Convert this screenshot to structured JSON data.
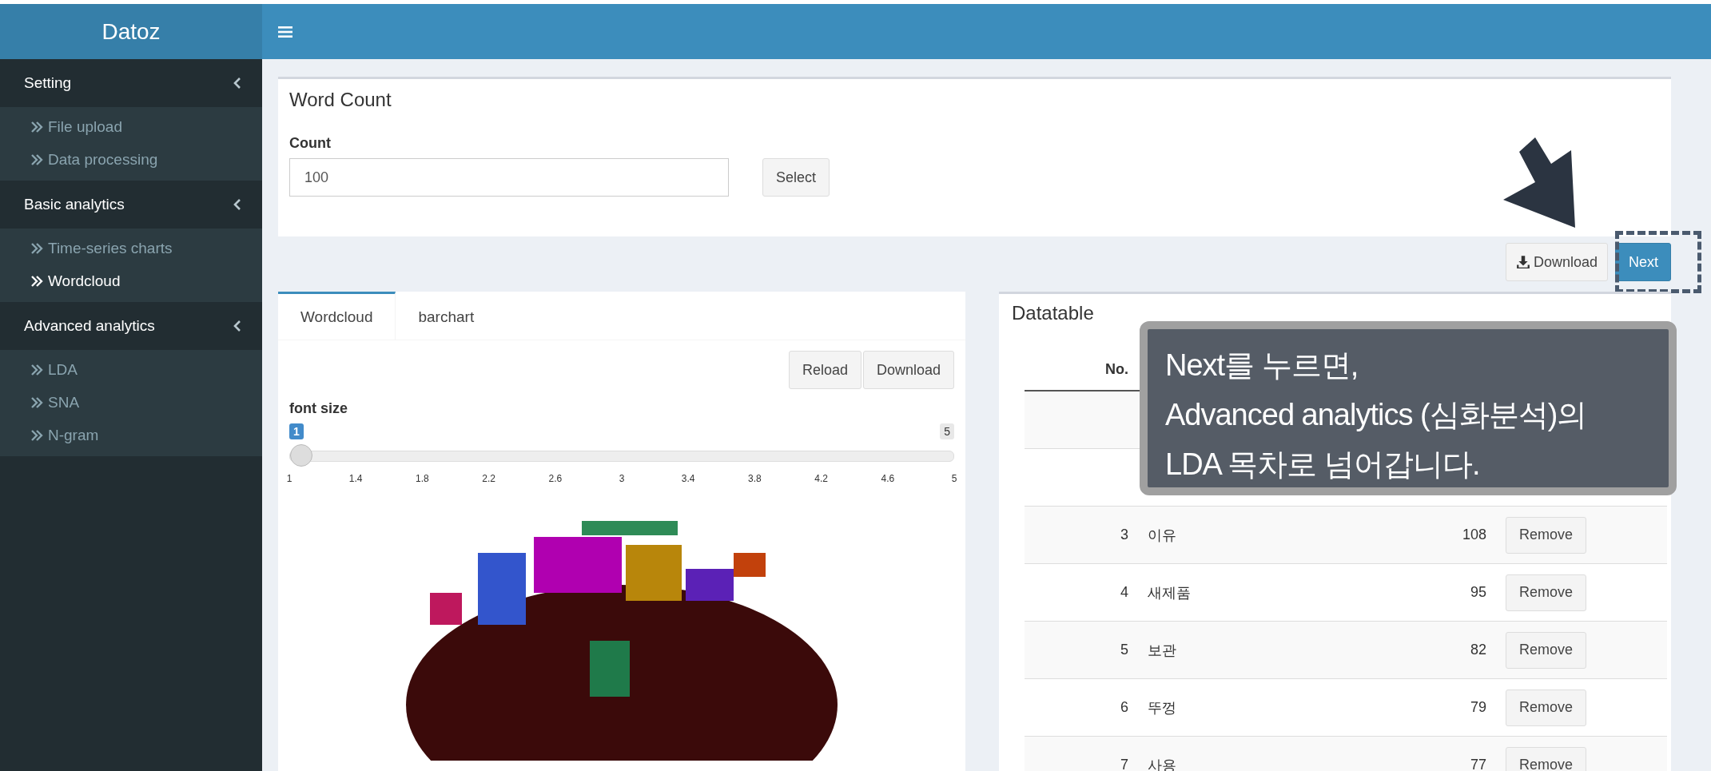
{
  "app": {
    "title": "Datoz"
  },
  "sidebar": {
    "sections": [
      {
        "label": "Setting",
        "items": [
          {
            "label": "File upload",
            "selected": false
          },
          {
            "label": "Data processing",
            "selected": false
          }
        ]
      },
      {
        "label": "Basic analytics",
        "items": [
          {
            "label": "Time-series charts",
            "selected": false
          },
          {
            "label": "Wordcloud",
            "selected": true
          }
        ]
      },
      {
        "label": "Advanced analytics",
        "items": [
          {
            "label": "LDA",
            "selected": false
          },
          {
            "label": "SNA",
            "selected": false
          },
          {
            "label": "N-gram",
            "selected": false
          }
        ]
      }
    ]
  },
  "word_count": {
    "title": "Word Count",
    "count_label": "Count",
    "count_value": "100",
    "select_button": "Select"
  },
  "actions": {
    "download": "Download",
    "next": "Next"
  },
  "wordcloud_panel": {
    "tabs": [
      {
        "label": "Wordcloud",
        "selected": true
      },
      {
        "label": "barchart",
        "selected": false
      }
    ],
    "buttons": [
      "Reload",
      "Download"
    ],
    "slider": {
      "label": "font size",
      "value": "1",
      "max": "5",
      "level": 0,
      "ticks": [
        "1",
        "1.4",
        "1.8",
        "2.2",
        "2.6",
        "3",
        "3.4",
        "3.8",
        "4.2",
        "4.6",
        "5"
      ]
    }
  },
  "datatable": {
    "title": "Datatable",
    "columns": [
      "No."
    ],
    "rows": [
      {
        "no": "3",
        "word": "이유",
        "freq": "108",
        "action": "Remove"
      },
      {
        "no": "4",
        "word": "새제품",
        "freq": "95",
        "action": "Remove"
      },
      {
        "no": "5",
        "word": "보관",
        "freq": "82",
        "action": "Remove"
      },
      {
        "no": "6",
        "word": "뚜껑",
        "freq": "79",
        "action": "Remove"
      },
      {
        "no": "7",
        "word": "사용",
        "freq": "77",
        "action": "Remove"
      }
    ]
  },
  "callout": {
    "lines": [
      "Next를 누르면,",
      "Advanced analytics (심화분석)의",
      "LDA 목차로 넘어갑니다."
    ]
  }
}
